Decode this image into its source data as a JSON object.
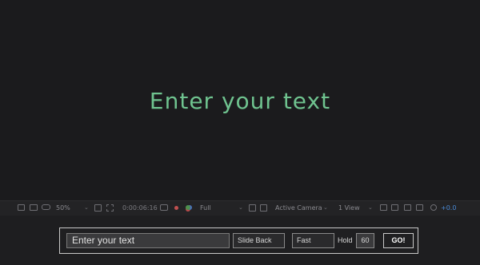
{
  "viewer": {
    "preview_text": "Enter your text"
  },
  "toolbar": {
    "zoom": "50%",
    "timecode": "0:00:06:16",
    "resolution": "Full",
    "camera": "Active Camera",
    "views": "1 View",
    "exposure": "+0.0",
    "icons": [
      "snapshot-icon",
      "region-icon",
      "mask-icon",
      "grid-icon",
      "camera-icon",
      "color-channel-icon",
      "transparency-icon",
      "3d-view-icon",
      "render-icon",
      "flowchart-icon",
      "exposure-icon"
    ],
    "accent": "#4a8ad6"
  },
  "controls": {
    "text_value": "Enter your text",
    "direction": "Slide Back",
    "speed": "Fast",
    "hold_label": "Hold",
    "hold_value": "60",
    "go_label": "GO!"
  },
  "colors": {
    "preview_text": "#6fc38f",
    "background": "#1b1b1d"
  }
}
